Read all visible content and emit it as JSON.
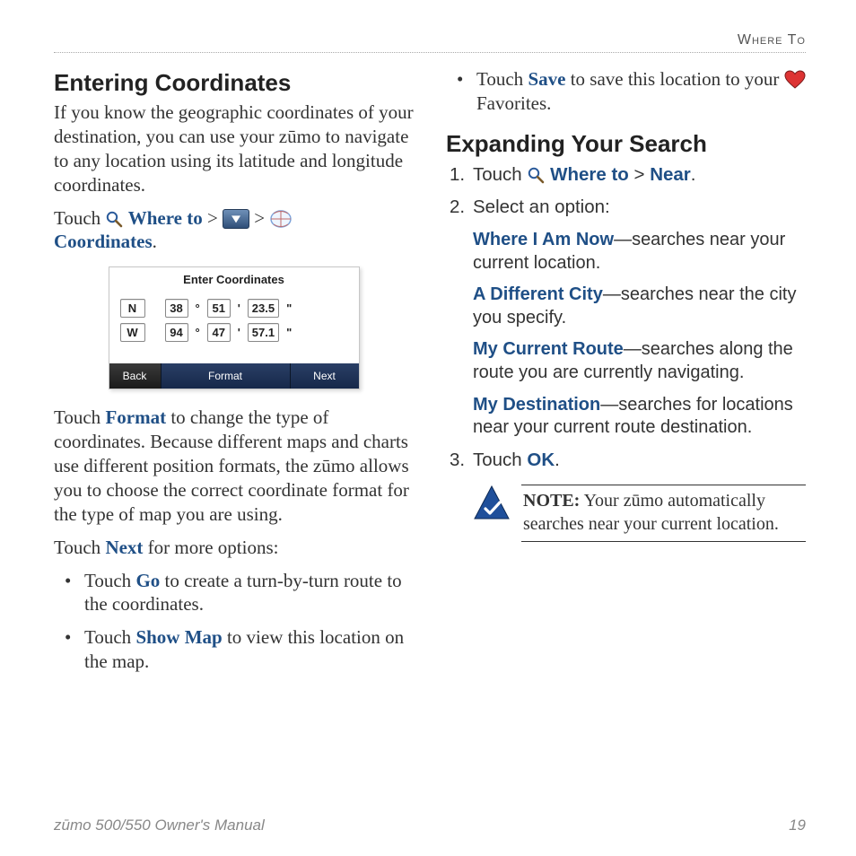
{
  "header": {
    "section": "Where To"
  },
  "footer": {
    "manual": "zūmo 500/550 Owner's Manual",
    "page": "19"
  },
  "left": {
    "h1": "Entering Coordinates",
    "intro": "If you know the geographic coordinates of your destination, you can use your zūmo to navigate to any location using its latitude and longitude coordinates.",
    "touch1_a": "Touch ",
    "where_to": "Where to",
    "sep": " > ",
    "coords": "Coordinates",
    "period": ".",
    "screenshot": {
      "title": "Enter Coordinates",
      "row1": {
        "dir": "N",
        "deg": "38",
        "min": "51",
        "sec": "23.5"
      },
      "row2": {
        "dir": "W",
        "deg": "94",
        "min": "47",
        "sec": "57.1"
      },
      "deg_sym": "°",
      "min_sym": "'",
      "sec_sym": "\"",
      "back": "Back",
      "format": "Format",
      "next": "Next"
    },
    "format_pre": "Touch ",
    "format_link": "Format",
    "format_post": " to change the type of coordinates. Because different maps and charts use different position formats, the zūmo allows you to choose the correct coordinate format for the type of map you are using.",
    "next_pre": "Touch ",
    "next_link": "Next",
    "next_post": " for more options:",
    "bullets": [
      {
        "pre": "Touch ",
        "link": "Go",
        "post": " to create a turn-by-turn route to the coordinates."
      },
      {
        "pre": "Touch ",
        "link": "Show Map",
        "post": " to view this location on the map."
      }
    ]
  },
  "right": {
    "top_bullet": {
      "pre": "Touch ",
      "link": "Save",
      "post_a": " to save this location to your ",
      "post_b": " Favorites."
    },
    "h1": "Expanding Your Search",
    "steps": {
      "s1_pre": "Touch ",
      "s1_link1": "Where to",
      "s1_sep": " > ",
      "s1_link2": "Near",
      "s1_period": ".",
      "s2": "Select an option:",
      "s3_pre": "Touch ",
      "s3_link": "OK",
      "s3_period": "."
    },
    "options": [
      {
        "lead": "Where I Am Now",
        "rest": "—searches near your current location."
      },
      {
        "lead": "A Different City",
        "rest": "—searches near the city you specify."
      },
      {
        "lead": "My Current Route",
        "rest": "—searches along the route you are currently navigating."
      },
      {
        "lead": "My Destination",
        "rest": "—searches for locations near your current route destination."
      }
    ],
    "note_strong": "NOTE:",
    "note_rest": " Your zūmo automatically searches near your current location."
  }
}
